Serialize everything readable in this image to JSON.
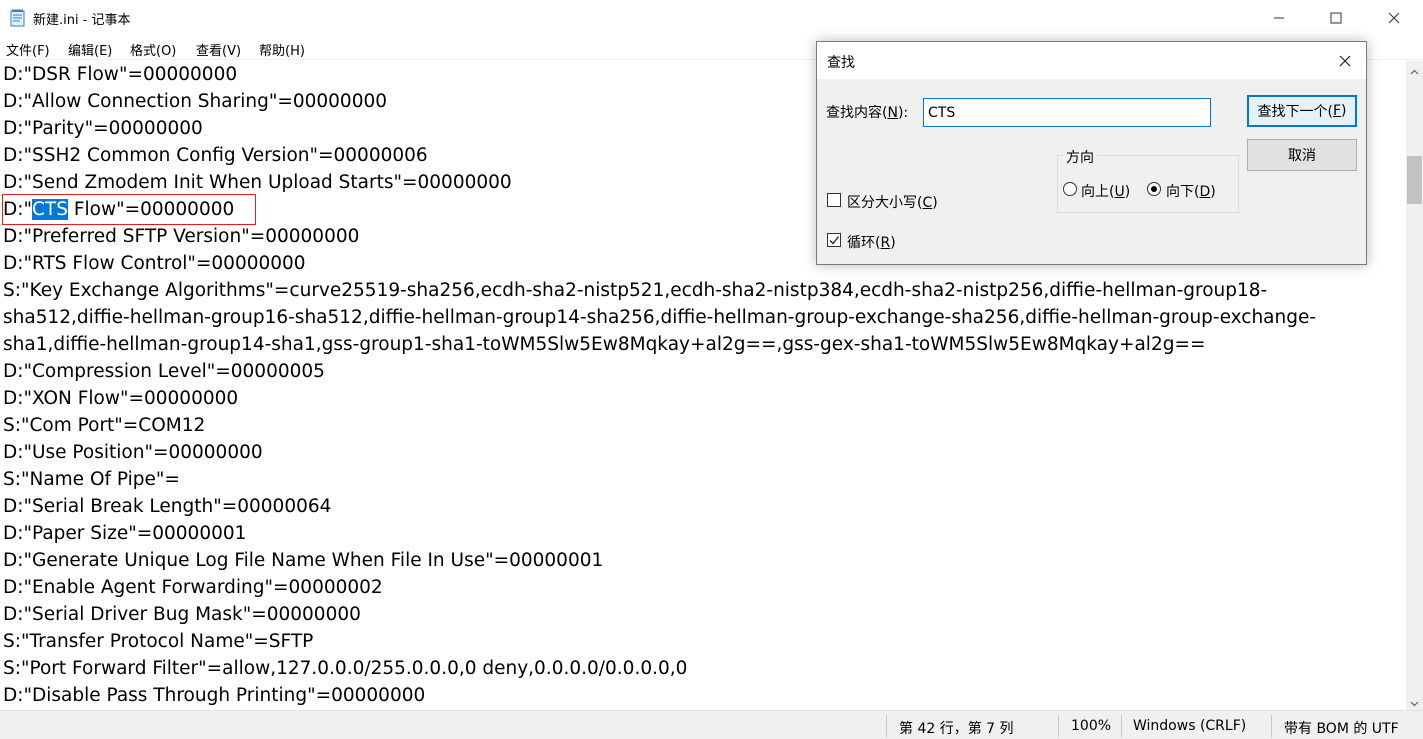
{
  "window": {
    "title": "新建.ini - 记事本",
    "icon": "notepad-icon"
  },
  "menu": {
    "file": "文件(F)",
    "edit": "编辑(E)",
    "format": "格式(O)",
    "view": "查看(V)",
    "help": "帮助(H)"
  },
  "editor": {
    "lines": [
      "D:\"DSR Flow\"=00000000",
      "D:\"Allow Connection Sharing\"=00000000",
      "D:\"Parity\"=00000000",
      "D:\"SSH2 Common Config Version\"=00000006",
      "D:\"Send Zmodem Init When Upload Starts\"=00000000",
      "D:\"CTS Flow\"=00000000",
      "D:\"Preferred SFTP Version\"=00000000",
      "D:\"RTS Flow Control\"=00000000",
      "S:\"Key Exchange Algorithms\"=curve25519-sha256,ecdh-sha2-nistp521,ecdh-sha2-nistp384,ecdh-sha2-nistp256,diffie-hellman-group18-",
      "sha512,diffie-hellman-group16-sha512,diffie-hellman-group14-sha256,diffie-hellman-group-exchange-sha256,diffie-hellman-group-exchange-",
      "sha1,diffie-hellman-group14-sha1,gss-group1-sha1-toWM5Slw5Ew8Mqkay+al2g==,gss-gex-sha1-toWM5Slw5Ew8Mqkay+al2g==",
      "D:\"Compression Level\"=00000005",
      "D:\"XON Flow\"=00000000",
      "S:\"Com Port\"=COM12",
      "D:\"Use Position\"=00000000",
      "S:\"Name Of Pipe\"=",
      "D:\"Serial Break Length\"=00000064",
      "D:\"Paper Size\"=00000001",
      "D:\"Generate Unique Log File Name When File In Use\"=00000001",
      "D:\"Enable Agent Forwarding\"=00000002",
      "D:\"Serial Driver Bug Mask\"=00000000",
      "S:\"Transfer Protocol Name\"=SFTP",
      "S:\"Port Forward Filter\"=allow,127.0.0.0/255.0.0.0,0 deny,0.0.0.0/0.0.0.0,0",
      "D:\"Disable Pass Through Printing\"=00000000"
    ],
    "cts_line": {
      "prefix": "D:\"",
      "selected": "CTS",
      "suffix": " Flow\"=00000000"
    }
  },
  "status": {
    "position": "第 42 行，第 7 列",
    "zoom": "100%",
    "line_ending": "Windows (CRLF)",
    "encoding": "带有 BOM 的 UTF"
  },
  "find_dialog": {
    "title": "查找",
    "find_label": "查找内容(",
    "find_label_key": "N",
    "find_label_tail": "):",
    "find_value": "CTS",
    "find_next_label": "查找下一个(",
    "find_next_key": "F",
    "find_next_tail": ")",
    "cancel_label": "取消",
    "direction_label": "方向",
    "up_label": "向上(",
    "up_key": "U",
    "up_tail": ")",
    "down_label": "向下(",
    "down_key": "D",
    "down_tail": ")",
    "direction_selected": "down",
    "match_case_label": "区分大小写(",
    "match_case_key": "C",
    "match_case_tail": ")",
    "match_case_checked": false,
    "wrap_label": "循环(",
    "wrap_key": "R",
    "wrap_tail": ")",
    "wrap_checked": true
  },
  "colors": {
    "selection": "#0078d7",
    "match_outline": "#e02020"
  }
}
